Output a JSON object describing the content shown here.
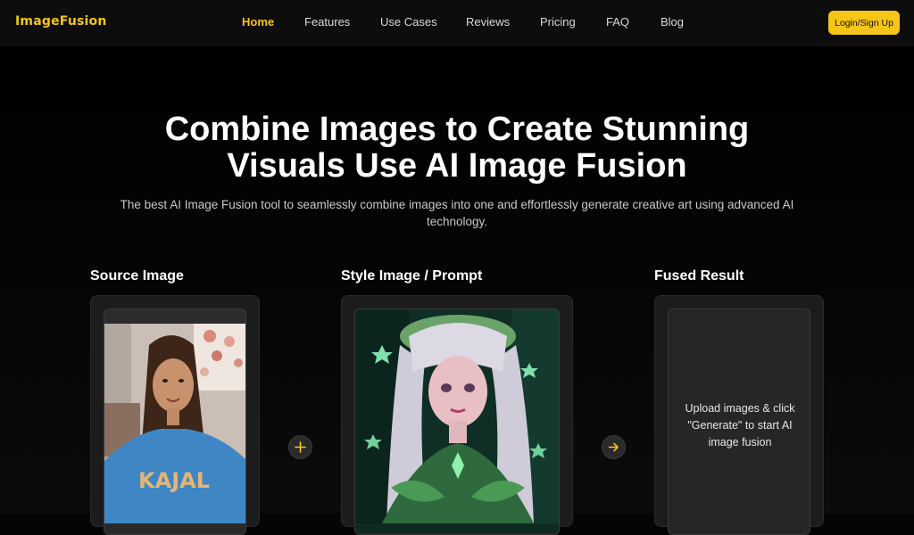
{
  "nav": {
    "logo": "ImageFusion",
    "links": [
      "Home",
      "Features",
      "Use Cases",
      "Reviews",
      "Pricing",
      "FAQ",
      "Blog"
    ],
    "login_label": "Login/Sign Up",
    "accent_color": "#f5c518"
  },
  "hero": {
    "title_line1": "Combine Images to Create Stunning",
    "title_line2": "Visuals Use AI Image Fusion",
    "subtitle_line1": "The best AI Image Fusion tool to seamlessly combine images into one and effortlessly generate creative art using advanced AI",
    "subtitle_line2": "technology."
  },
  "panels": {
    "source": {
      "label": "Source Image",
      "shirt_text": "KAJAL"
    },
    "style": {
      "label": "Style Image / Prompt"
    },
    "result": {
      "label": "Fused Result",
      "placeholder_line1": "Upload images & click",
      "placeholder_line2": "\"Generate\" to start AI",
      "placeholder_line3": "image fusion"
    }
  },
  "icons": {
    "plus": "plus-icon",
    "arrow": "arrow-right-icon"
  }
}
